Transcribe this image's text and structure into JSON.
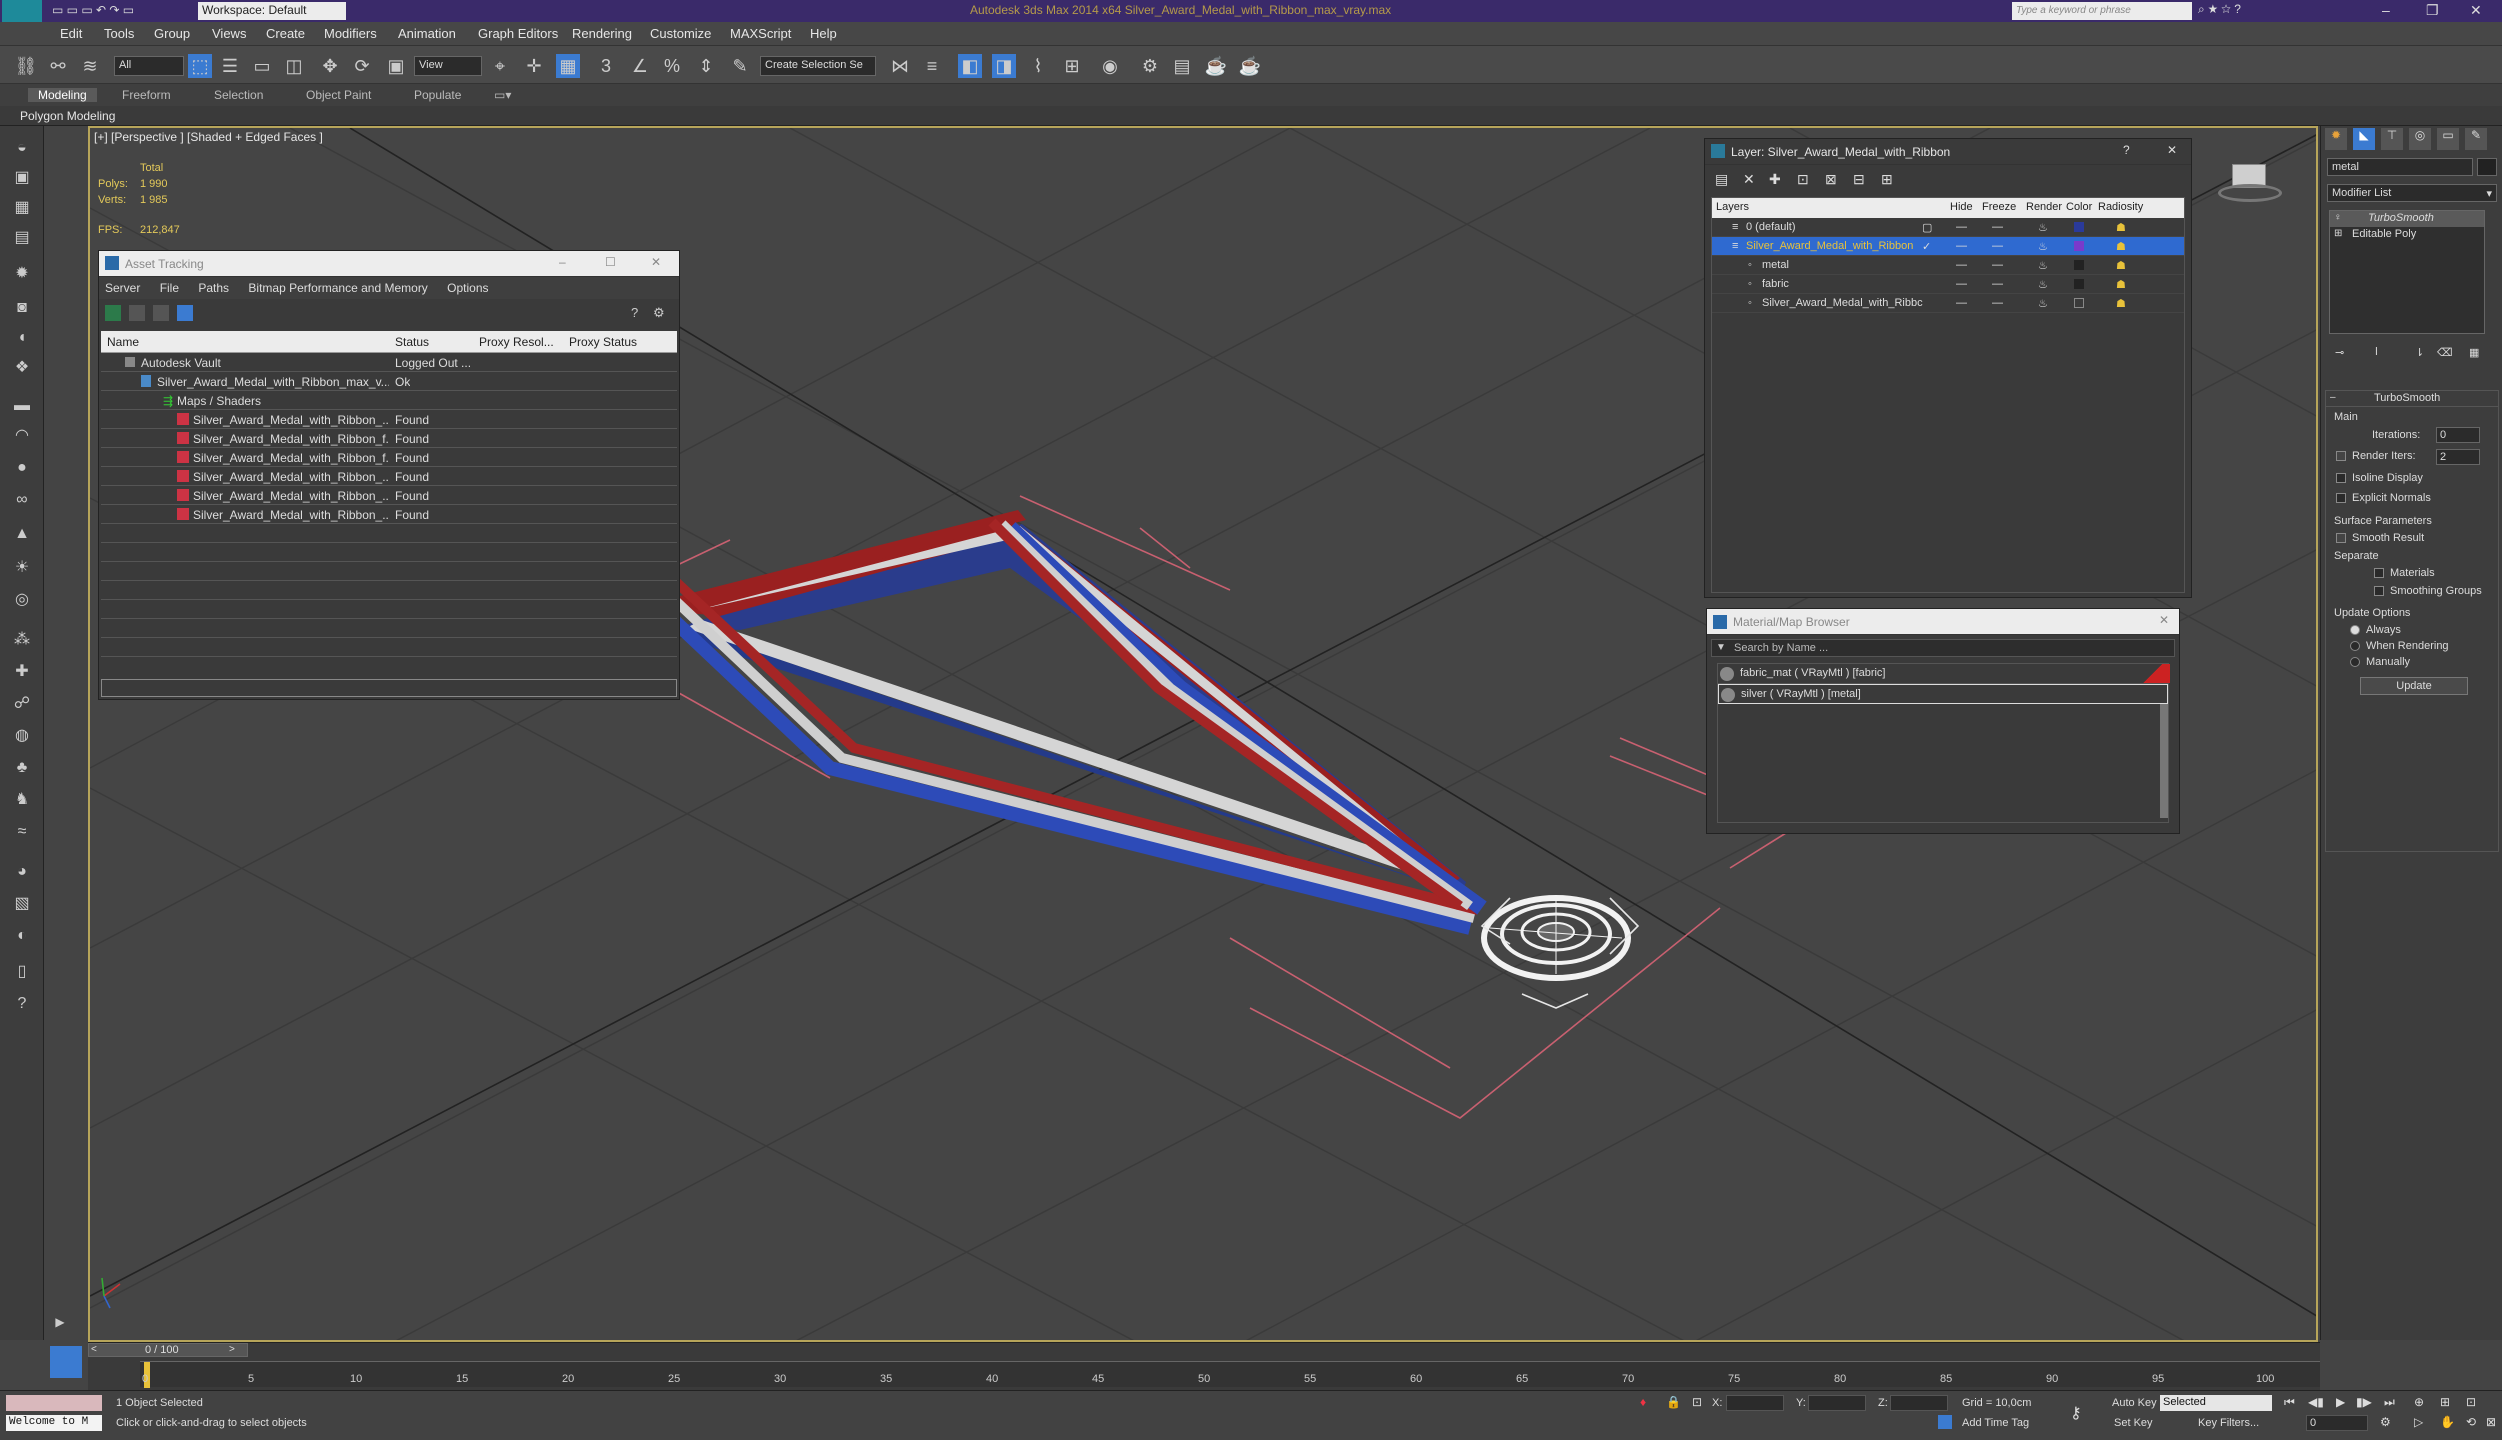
{
  "app": {
    "title": "Autodesk 3ds Max  2014 x64     Silver_Award_Medal_with_Ribbon_max_vray.max",
    "workspace": "Workspace: Default",
    "search_placeholder": "Type a keyword or phrase"
  },
  "menu": [
    "Edit",
    "Tools",
    "Group",
    "Views",
    "Create",
    "Modifiers",
    "Animation",
    "Graph Editors",
    "Rendering",
    "Customize",
    "MAXScript",
    "Help"
  ],
  "toolbar": {
    "filter_value": "All",
    "view_value": "View",
    "selection_set_placeholder": "Create Selection Se"
  },
  "ribbon": {
    "tabs": [
      "Modeling",
      "Freeform",
      "Selection",
      "Object Paint",
      "Populate"
    ],
    "sub_label": "Polygon Modeling"
  },
  "viewport": {
    "label": "[+] [Perspective ] [Shaded + Edged Faces ]",
    "stats": {
      "total": "Total",
      "polys_label": "Polys:",
      "polys": "1 990",
      "verts_label": "Verts:",
      "verts": "1 985",
      "fps_label": "FPS:",
      "fps": "212,847"
    }
  },
  "asset_tracking": {
    "title": "Asset Tracking",
    "menu": [
      "Server",
      "File",
      "Paths",
      "Bitmap Performance and Memory",
      "Options"
    ],
    "columns": [
      "Name",
      "Status",
      "Proxy Resol...",
      "Proxy Status"
    ],
    "rows": [
      {
        "name": "Autodesk Vault",
        "status": "Logged Out ..."
      },
      {
        "name": "Silver_Award_Medal_with_Ribbon_max_v...",
        "status": "Ok"
      },
      {
        "name": "Maps / Shaders",
        "status": ""
      },
      {
        "name": "Silver_Award_Medal_with_Ribbon_...",
        "status": "Found"
      },
      {
        "name": "Silver_Award_Medal_with_Ribbon_f...",
        "status": "Found"
      },
      {
        "name": "Silver_Award_Medal_with_Ribbon_f...",
        "status": "Found"
      },
      {
        "name": "Silver_Award_Medal_with_Ribbon_...",
        "status": "Found"
      },
      {
        "name": "Silver_Award_Medal_with_Ribbon_...",
        "status": "Found"
      },
      {
        "name": "Silver_Award_Medal_with_Ribbon_...",
        "status": "Found"
      }
    ]
  },
  "layers": {
    "title": "Layer: Silver_Award_Medal_with_Ribbon",
    "help": "?",
    "columns": [
      "Layers",
      "Hide",
      "Freeze",
      "Render",
      "Color",
      "Radiosity"
    ],
    "rows": [
      {
        "name": "0 (default)"
      },
      {
        "name": "Silver_Award_Medal_with_Ribbon"
      },
      {
        "name": "metal"
      },
      {
        "name": "fabric"
      },
      {
        "name": "Silver_Award_Medal_with_Ribbc"
      }
    ]
  },
  "material_browser": {
    "title": "Material/Map Browser",
    "search_placeholder": "Search by Name ...",
    "items": [
      "fabric_mat  ( VRayMtl ) [fabric]",
      "silver  ( VRayMtl ) [metal]"
    ]
  },
  "modify_panel": {
    "name_value": "metal",
    "modifier_list": "Modifier List",
    "stack": [
      "TurboSmooth",
      "Editable Poly"
    ],
    "rollout_title": "TurboSmooth",
    "main_label": "Main",
    "iterations_label": "Iterations:",
    "iterations": "0",
    "render_iters_label": "Render Iters:",
    "render_iters": "2",
    "isoline": "Isoline Display",
    "explicit_normals": "Explicit Normals",
    "surface_params": "Surface Parameters",
    "smooth_result": "Smooth Result",
    "separate": "Separate",
    "materials": "Materials",
    "smoothing_groups": "Smoothing Groups",
    "update_options": "Update Options",
    "always": "Always",
    "when_rendering": "When Rendering",
    "manually": "Manually",
    "update_button": "Update"
  },
  "timeline": {
    "frame_counter": "0 / 100",
    "ticks": [
      "0",
      "5",
      "10",
      "15",
      "20",
      "25",
      "30",
      "35",
      "40",
      "45",
      "50",
      "55",
      "60",
      "65",
      "70",
      "75",
      "80",
      "85",
      "90",
      "95",
      "100"
    ]
  },
  "status": {
    "maxscript": "Welcome to M",
    "selected": "1 Object Selected",
    "prompt": "Click or click-and-drag to select objects",
    "x_label": "X:",
    "y_label": "Y:",
    "z_label": "Z:",
    "grid": "Grid = 10,0cm",
    "add_time_tag": "Add Time Tag",
    "auto_key": "Auto Key",
    "set_key": "Set Key",
    "selected_dropdown": "Selected",
    "key_filters": "Key Filters...",
    "frame_value": "0"
  }
}
